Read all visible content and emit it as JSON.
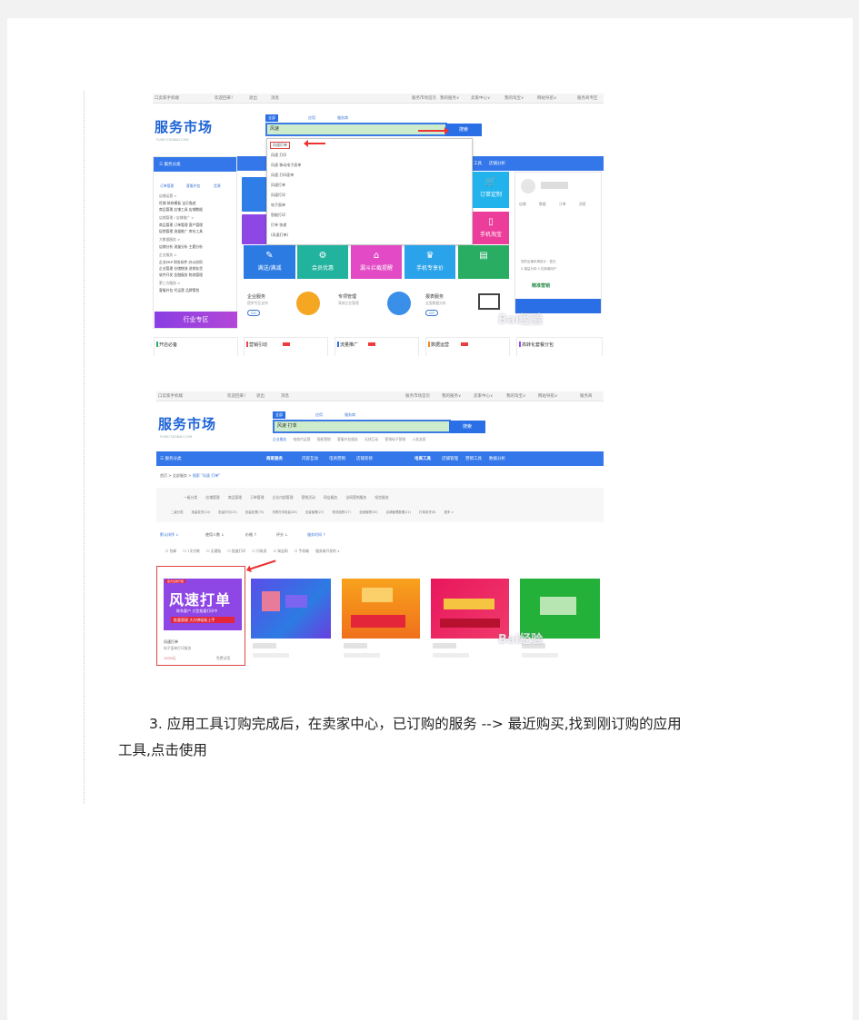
{
  "shot1": {
    "topbar": [
      "口卖家手机端",
      "欢迎回来！",
      "退出",
      "消息",
      "服务市场首页",
      "我的服务∨",
      "卖家中心∨",
      "我的淘宝∨",
      "网站导航∨",
      "服务商专区"
    ],
    "logo": "服务市场",
    "logo_sub": "FUWU.TAOBAO.COM",
    "search_tabs": [
      "全部",
      "应用",
      "服务商"
    ],
    "search_value": "风速",
    "search_button": "搜索",
    "dropdown_items": [
      "风速打单",
      "风速 打印",
      "风速 移动电子面单",
      "风速 打印面单",
      "风速打单",
      "风速打印",
      "电子面单",
      "智能打印",
      "打单 快递",
      "(风速打单)"
    ],
    "sidebar_header": "服务分类",
    "sidebar_top": [
      "订单管理",
      "客服外包",
      "货源"
    ],
    "sidebar_rows": [
      "店铺运营 >",
      "旺铺    装修模板    宝贝描述",
      "商品管理    店铺工具    店铺数据",
      "店铺管理 / 店铺推广 >",
      "商品管理    订单管理    客户管理",
      "促销管理    流量推广    库存工具",
      "大数据服务 >",
      "店铺分析    流量分析    主题分析",
      "企业服务 >",
      "企业ERP    财务软件    办公协同",
      "企业管理    仓储物流    进销存货",
      "软件开发    金融服务    物流管理",
      "第三方服务 >",
      "客服外包    代运营    品牌策划"
    ],
    "industry_label": "行业专区",
    "nav_items": [
      "工具",
      "店铺分析"
    ],
    "tiles": [
      {
        "label": "满送/满减",
        "icon": "✎",
        "color": "#2c7be3"
      },
      {
        "label": "会员优惠",
        "icon": "⚙",
        "color": "#22b39e"
      },
      {
        "label": "漏斗拦截提醒",
        "icon": "⌂",
        "color": "#e24ac6"
      },
      {
        "label": "手机专享价",
        "icon": "♛",
        "color": "#2ba3ea"
      },
      {
        "label": "",
        "icon": "▤",
        "color": "#28ad63"
      }
    ],
    "right_tiles": [
      "订单定制",
      "手机淘宝"
    ],
    "service_items": [
      {
        "title": "企业服务",
        "sub": "提供专业支持",
        "btn": "GO"
      },
      {
        "title": "专项管理",
        "sub": "高效企业管理",
        "btn": ""
      },
      {
        "title": "报表服务",
        "sub": "全面数据分析",
        "btn": "GO"
      }
    ],
    "user_sub": [
      "店铺",
      "数据",
      "订单",
      "消息"
    ],
    "user_promo": [
      "您的店铺本周统计：暂无",
      "0 增益为你 0 位新增用户"
    ],
    "user_promo_title": "精准营销",
    "bottom_cards": [
      "开店必备",
      "营销引动",
      "流量推广",
      "数据运营",
      "高转化套餐分包"
    ],
    "watermark": "Bai经验"
  },
  "shot2": {
    "topbar": [
      "口卖家手机端",
      "欢迎回来！",
      "退出",
      "消息",
      "服务市场首页",
      "我的服务∨",
      "卖家中心∨",
      "我的淘宝∨",
      "网站导航∨",
      "服务商"
    ],
    "logo": "服务市场",
    "logo_sub": "FUWU.TAOBAO.COM",
    "search_tabs": [
      "全部",
      "应用",
      "服务商"
    ],
    "search_value": "风速 打单",
    "search_button": "搜索",
    "search_suggest": [
      "企业服务",
      "电商代运营",
      "智能营销",
      "客服外包服务",
      "无线互动",
      "营销电子营销",
      "入驻卖家"
    ],
    "sidebar_header": "服务分类",
    "nav_items": [
      "商家服务",
      "内容互动",
      "电商营销",
      "店铺装修",
      "电商工具",
      "店铺管理",
      "营销工具",
      "数据分析"
    ],
    "breadcrumb": [
      "首页",
      "全部服务",
      "搜索 \"风速 打单\""
    ],
    "filter_rows": [
      [
        "一级分类",
        "店铺管理",
        "商品管理",
        "订单管理",
        "企业内部管理",
        "营销活动",
        "网店服务",
        "全网营销服务",
        "短信服务"
      ],
      [
        "二级分类",
        "批量发货(10)",
        "批量打印(15)",
        "批量处理(70)",
        "关联打印批量(26)",
        "全量管理(27)",
        "物流追踪(27)",
        "全面管理(33)",
        "店铺管理数据(21)",
        "打单发货(8)",
        "更多 ∨"
      ]
    ],
    "sort_items": [
      "默认排序 ↓",
      "使用人数 ↓",
      "价格 ↑",
      "评分 ↓",
      "服务时间 ↑"
    ],
    "check_items": [
      "包邮",
      "7天付款",
      "无理赔",
      "批量打印",
      "闪电发",
      "淘宝网",
      "手机端",
      "服务商开发的 ∨"
    ],
    "products": [
      {
        "title": "风速打单",
        "tag": "官方全新升级",
        "sub": "联系客户 大型批量打印中",
        "bar": "批量直接 大分钟轻松上手",
        "line1": "风速打单",
        "line2": "电子面单打印服务",
        "line3": "1529元",
        "line3b": "免费试用"
      },
      {
        "line1": "",
        "line2": "",
        "line3": ""
      },
      {
        "line1": "",
        "line2": "",
        "line3": ""
      },
      {
        "line1": "",
        "line2": "",
        "line3": ""
      },
      {
        "line1": "",
        "line2": "",
        "line3": ""
      }
    ],
    "watermark": "Bai经验"
  },
  "paragraph": {
    "line1": "3. 应用工具订购完成后，在卖家中心，已订购的服务 --> 最近购买,找到刚订购的应用",
    "line2": "工具,点击使用"
  }
}
